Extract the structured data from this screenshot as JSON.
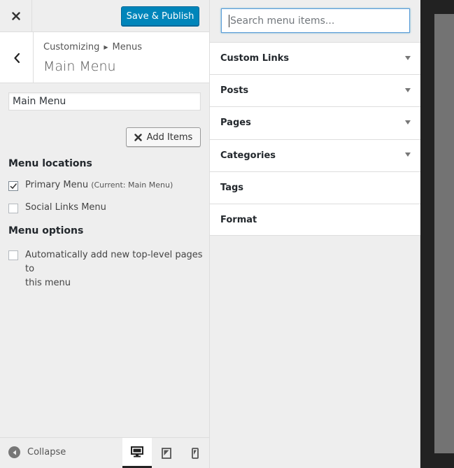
{
  "topbar": {
    "publish_label": "Save & Publish"
  },
  "header": {
    "breadcrumb_root": "Customizing",
    "breadcrumb_current": "Menus",
    "title": "Main Menu"
  },
  "menu_name": {
    "value": "Main Menu"
  },
  "add_items": {
    "label": "Add Items"
  },
  "locations": {
    "heading": "Menu locations",
    "items": [
      {
        "label": "Primary Menu",
        "note": "(Current: Main Menu)",
        "checked": true
      },
      {
        "label": "Social Links Menu",
        "note": "",
        "checked": false
      }
    ]
  },
  "options": {
    "heading": "Menu options",
    "auto_add_line1": "Automatically add new top-level pages to",
    "auto_add_line2": "this menu"
  },
  "footer": {
    "collapse_label": "Collapse"
  },
  "available": {
    "search_placeholder": "Search menu items...",
    "sections": [
      {
        "label": "Custom Links",
        "has_arrow": true
      },
      {
        "label": "Posts",
        "has_arrow": true
      },
      {
        "label": "Pages",
        "has_arrow": true
      },
      {
        "label": "Categories",
        "has_arrow": true
      },
      {
        "label": "Tags",
        "has_arrow": false
      },
      {
        "label": "Format",
        "has_arrow": false
      }
    ]
  },
  "colors": {
    "primary": "#0085ba",
    "panel_bg": "#eeeeee",
    "preview_bg": "#222222"
  }
}
